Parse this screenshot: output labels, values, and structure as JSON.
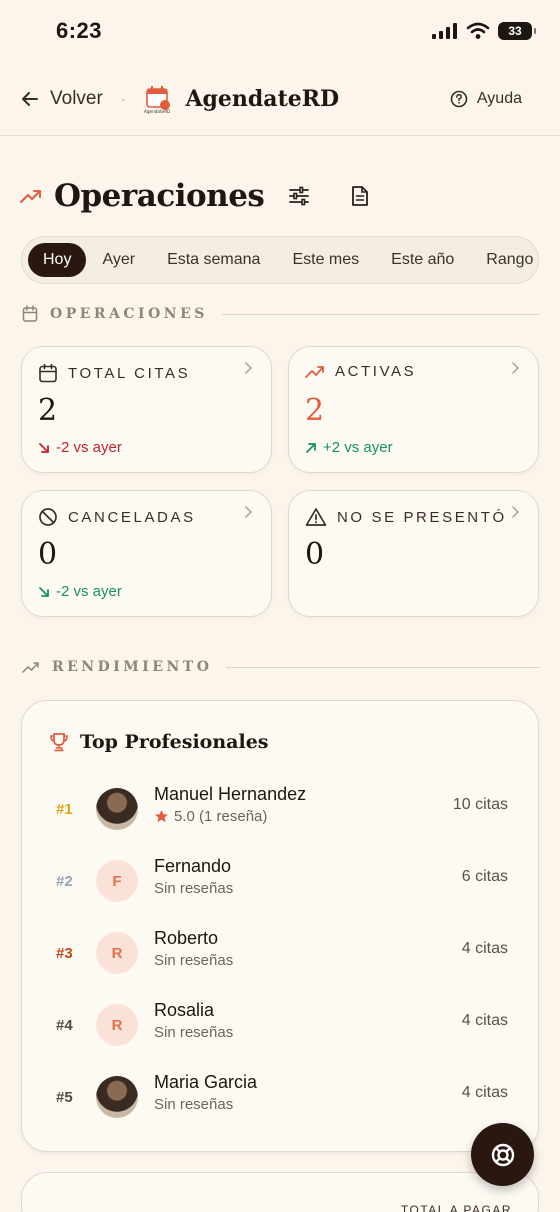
{
  "status_bar": {
    "time": "6:23",
    "battery": "33"
  },
  "header": {
    "back_label": "Volver",
    "separator": "·",
    "brand": "AgendateRD",
    "logo_caption": "AgendateRD",
    "help_label": "Ayuda"
  },
  "page": {
    "title": "Operaciones"
  },
  "period_tabs": [
    {
      "label": "Hoy",
      "active": true
    },
    {
      "label": "Ayer"
    },
    {
      "label": "Esta semana"
    },
    {
      "label": "Este mes"
    },
    {
      "label": "Este año"
    },
    {
      "label": "Rango"
    }
  ],
  "sections": {
    "operations": "OPERACIONES",
    "performance": "RENDIMIENTO"
  },
  "stats": [
    {
      "title": "TOTAL CITAS",
      "value": "2",
      "trend": "-2 vs ayer",
      "trend_color": "#c8222c",
      "value_color": "#1e1610",
      "icon": "calendar-icon"
    },
    {
      "title": "ACTIVAS",
      "value": "2",
      "trend": "+2 vs ayer",
      "trend_color": "#17935d",
      "value_color": "#e25d3e",
      "icon": "trending-up-icon"
    },
    {
      "title": "CANCELADAS",
      "value": "0",
      "trend": "-2 vs ayer",
      "trend_color": "#17935d",
      "value_color": "#1e1610",
      "icon": "ban-icon"
    },
    {
      "title": "NO SE PRESENTÓ",
      "value": "0",
      "trend": "",
      "value_color": "#1e1610",
      "icon": "warning-icon"
    }
  ],
  "top_professionals": {
    "title": "Top Profesionales",
    "items": [
      {
        "rank": "#1",
        "rank_color": "#e0a21a",
        "name": "Manuel Hernandez",
        "rating": "5.0 (1 reseña)",
        "count": "10 citas",
        "avatar": "photo"
      },
      {
        "rank": "#2",
        "rank_color": "#97a3b8",
        "name": "Fernando",
        "rating": "Sin reseñas",
        "count": "6 citas",
        "initial": "F"
      },
      {
        "rank": "#3",
        "rank_color": "#bf4b1c",
        "name": "Roberto",
        "rating": "Sin reseñas",
        "count": "4 citas",
        "initial": "R"
      },
      {
        "rank": "#4",
        "rank_color": "#544a42",
        "name": "Rosalia",
        "rating": "Sin reseñas",
        "count": "4 citas",
        "initial": "R"
      },
      {
        "rank": "#5",
        "rank_color": "#544a42",
        "name": "Maria Garcia",
        "rating": "Sin reseñas",
        "count": "4 citas",
        "avatar": "photo"
      }
    ]
  },
  "bottom_card": {
    "label": "TOTAL A PAGAR"
  },
  "colors": {
    "accent": "#e25d3e",
    "dark": "#2a1710",
    "background": "#fbf5ec"
  }
}
